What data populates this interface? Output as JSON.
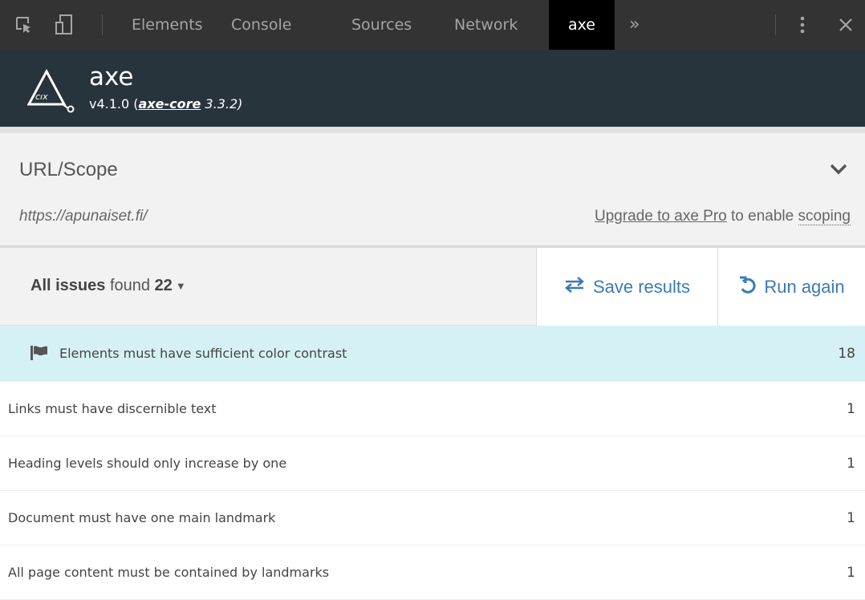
{
  "devtools": {
    "tabs": [
      "Elements",
      "Console",
      "Sources",
      "Network",
      "axe"
    ],
    "active_tab": "axe",
    "overflow": "»",
    "colors": {
      "bar": "#333333",
      "active": "#000000"
    }
  },
  "axe": {
    "title": "axe",
    "version": "v4.1.0 (",
    "core_link": "axe-core",
    "core_version": " 3.3.2)"
  },
  "scope": {
    "title": "URL/Scope",
    "url": "https://apunaiset.fi/",
    "upgrade_link": "Upgrade to axe Pro",
    "upgrade_middle": " to enable ",
    "upgrade_scoping": "scoping"
  },
  "toolbar": {
    "filter_bold": "All issues",
    "filter_found": " found ",
    "filter_count": "22",
    "save_label": "Save results",
    "run_label": "Run again"
  },
  "issues": [
    {
      "label": "Elements must have sufficient color contrast",
      "count": "18",
      "selected": true
    },
    {
      "label": "Links must have discernible text",
      "count": "1"
    },
    {
      "label": "Heading levels should only increase by one",
      "count": "1"
    },
    {
      "label": "Document must have one main landmark",
      "count": "1"
    },
    {
      "label": "All page content must be contained by landmarks",
      "count": "1"
    }
  ],
  "colors": {
    "header": "#27343c",
    "selected_row": "#d6f1f6",
    "accent": "#3a7ab8"
  }
}
